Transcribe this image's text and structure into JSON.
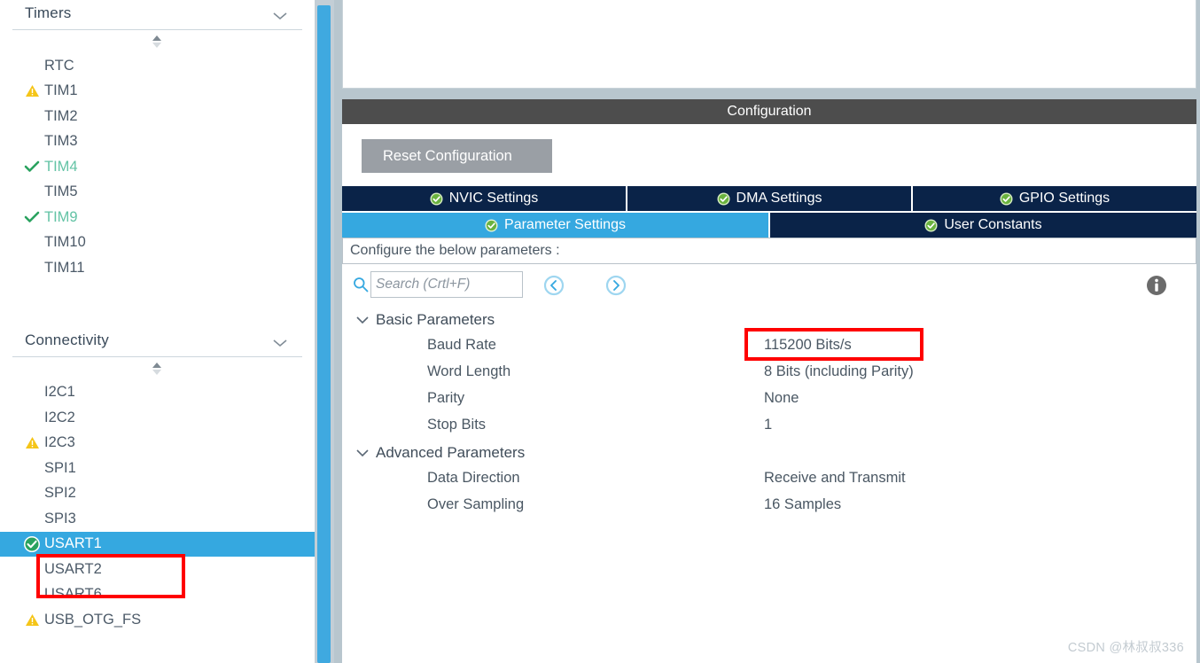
{
  "sidebar": {
    "sections": [
      {
        "title": "Timers",
        "chevron_icon": "chevron-down-icon",
        "sort_icon": "sort-arrows-icon",
        "items": [
          {
            "label": "RTC",
            "status": "none"
          },
          {
            "label": "TIM1",
            "status": "warning"
          },
          {
            "label": "TIM2",
            "status": "none"
          },
          {
            "label": "TIM3",
            "status": "none"
          },
          {
            "label": "TIM4",
            "status": "check"
          },
          {
            "label": "TIM5",
            "status": "none"
          },
          {
            "label": "TIM9",
            "status": "check"
          },
          {
            "label": "TIM10",
            "status": "none"
          },
          {
            "label": "TIM11",
            "status": "none"
          }
        ]
      },
      {
        "title": "Connectivity",
        "chevron_icon": "chevron-down-icon",
        "sort_icon": "sort-arrows-icon",
        "items": [
          {
            "label": "I2C1",
            "status": "none"
          },
          {
            "label": "I2C2",
            "status": "none"
          },
          {
            "label": "I2C3",
            "status": "warning"
          },
          {
            "label": "SPI1",
            "status": "none"
          },
          {
            "label": "SPI2",
            "status": "none"
          },
          {
            "label": "SPI3",
            "status": "none"
          },
          {
            "label": "USART1",
            "status": "enabled",
            "selected": true
          },
          {
            "label": "USART2",
            "status": "none"
          },
          {
            "label": "USART6",
            "status": "none"
          },
          {
            "label": "USB_OTG_FS",
            "status": "warning"
          }
        ]
      }
    ]
  },
  "main": {
    "configuration_title": "Configuration",
    "reset_button": "Reset Configuration",
    "tabs_row1": [
      {
        "label": "NVIC Settings",
        "icon": "green-check-icon",
        "active": false
      },
      {
        "label": "DMA Settings",
        "icon": "green-check-icon",
        "active": false
      },
      {
        "label": "GPIO Settings",
        "icon": "green-check-icon",
        "active": false
      }
    ],
    "tabs_row2": [
      {
        "label": "Parameter Settings",
        "icon": "green-check-icon",
        "active": true
      },
      {
        "label": "User Constants",
        "icon": "green-check-icon",
        "active": false
      }
    ],
    "configure_hint": "Configure the below parameters :",
    "search": {
      "placeholder": "Search (Crtl+F)",
      "value": "",
      "icon": "search-icon",
      "prev_icon": "circle-arrow-left-icon",
      "next_icon": "circle-arrow-right-icon",
      "info_icon": "info-icon"
    },
    "parameter_groups": [
      {
        "name": "Basic Parameters",
        "expand_icon": "chevron-down-icon",
        "rows": [
          {
            "name": "Baud Rate",
            "value": "115200 Bits/s",
            "highlighted": true
          },
          {
            "name": "Word Length",
            "value": "8 Bits (including Parity)"
          },
          {
            "name": "Parity",
            "value": "None"
          },
          {
            "name": "Stop Bits",
            "value": "1"
          }
        ]
      },
      {
        "name": "Advanced Parameters",
        "expand_icon": "chevron-down-icon",
        "rows": [
          {
            "name": "Data Direction",
            "value": "Receive and Transmit"
          },
          {
            "name": "Over Sampling",
            "value": "16 Samples"
          }
        ]
      }
    ]
  },
  "watermark": "CSDN @林叔叔336",
  "colors": {
    "accent_blue": "#35a8e0",
    "tab_navy": "#0a2348",
    "header_gray": "#4d4d4d",
    "ok_green": "#63c3a5",
    "warning_amber": "#f5c518",
    "annotation_red": "#ff0000",
    "panel_border": "#b8c6ce"
  }
}
